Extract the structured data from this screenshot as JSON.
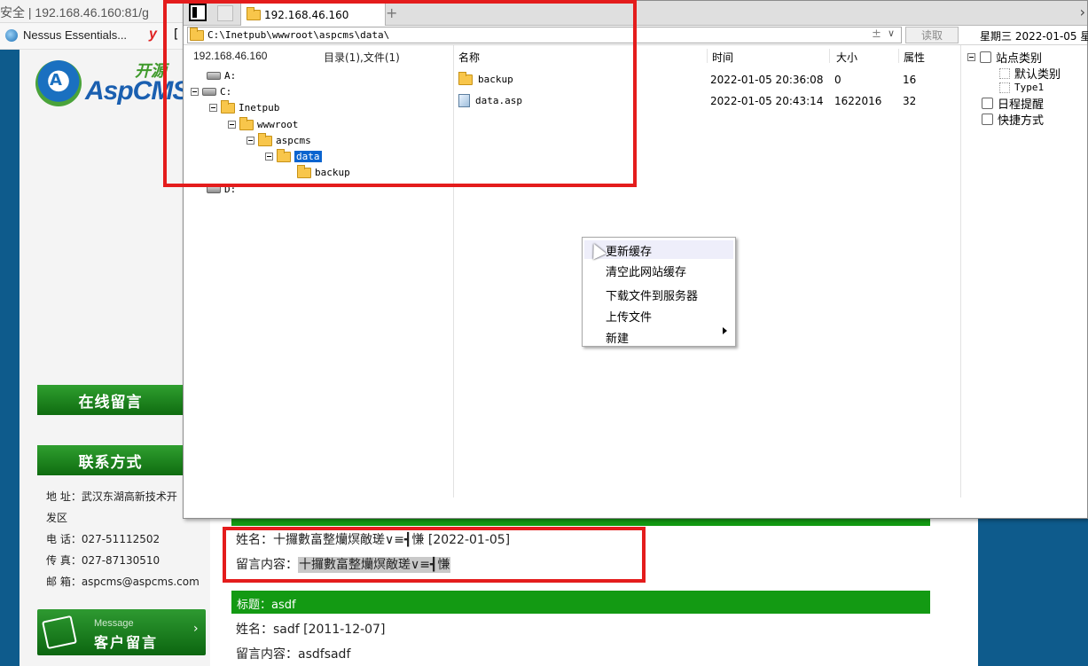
{
  "browser": {
    "url_fragment": "安全 | 192.168.46.160:81/g",
    "bookmark_label": "Nessus Essentials...",
    "bookmark_y": "y",
    "bookmark_bracket": "["
  },
  "site": {
    "logo_word": "AspCMS",
    "logo_tag": "开源",
    "online_message": "在线留言",
    "contact_heading": "联系方式",
    "contact": {
      "address": "地 址：武汉东湖高新技术开",
      "address_cont": "发区",
      "phone": "电 话：027-51112502",
      "fax": "传 真：027-87130510",
      "email": "邮 箱：aspcms@aspcms.com"
    },
    "msg_banner_en": "Message",
    "msg_banner_cn": "客户留言"
  },
  "guestbook": [
    {
      "name_line": "姓名：十攞數畗整爤熐敵瑳∨≡┫慊 [2022-01-05]",
      "content_label": "留言内容：",
      "content": "十攞數畗整爤熐敵瑳∨≡┫慊"
    },
    {
      "title": "标题：asdf",
      "name_line": "姓名：sadf [2011-12-07]",
      "content_line": "留言内容：asdfsadf"
    }
  ],
  "file_manager": {
    "tab_label": "192.168.46.160",
    "address": "C:\\Inetpub\\wwwroot\\aspcms\\data\\",
    "address_plus": "±",
    "read_button": "读取",
    "date_text": "星期三 2022-01-05 星",
    "left_header_ip": "192.168.46.160",
    "left_header_count": "目录(1),文件(1)",
    "columns": [
      "名称",
      "时间",
      "大小",
      "属性"
    ],
    "tree": [
      {
        "label": "A:",
        "kind": "drive"
      },
      {
        "label": "C:",
        "kind": "drive"
      },
      {
        "label": "Inetpub",
        "kind": "folder"
      },
      {
        "label": "wwwroot",
        "kind": "folder"
      },
      {
        "label": "aspcms",
        "kind": "folder"
      },
      {
        "label": "data",
        "kind": "folder",
        "selected": true
      },
      {
        "label": "backup",
        "kind": "folder"
      },
      {
        "label": "D:",
        "kind": "drive"
      }
    ],
    "files": [
      {
        "name": "backup",
        "kind": "folder",
        "time": "2022-01-05 20:36:08",
        "size": "0",
        "attr": "16"
      },
      {
        "name": "data.asp",
        "kind": "file",
        "time": "2022-01-05 20:43:14",
        "size": "1622016",
        "attr": "32"
      }
    ],
    "right_tree": [
      {
        "label": "站点类别",
        "icon": "site-category-icon"
      },
      {
        "label": "默认类别",
        "icon": "default-category-icon"
      },
      {
        "label": "Type1",
        "icon": "type1-icon"
      },
      {
        "label": "日程提醒",
        "icon": "schedule-reminder-icon"
      },
      {
        "label": "快捷方式",
        "icon": "shortcut-icon"
      }
    ]
  },
  "context_menu": {
    "items": [
      "更新缓存",
      "清空此网站缓存",
      "下载文件到服务器",
      "上传文件",
      "新建"
    ]
  },
  "colors": {
    "annotation_red": "#e41c1c",
    "site_green": "#139a13",
    "selection_blue": "#0a64cf",
    "page_blue": "#0e5b8c"
  }
}
